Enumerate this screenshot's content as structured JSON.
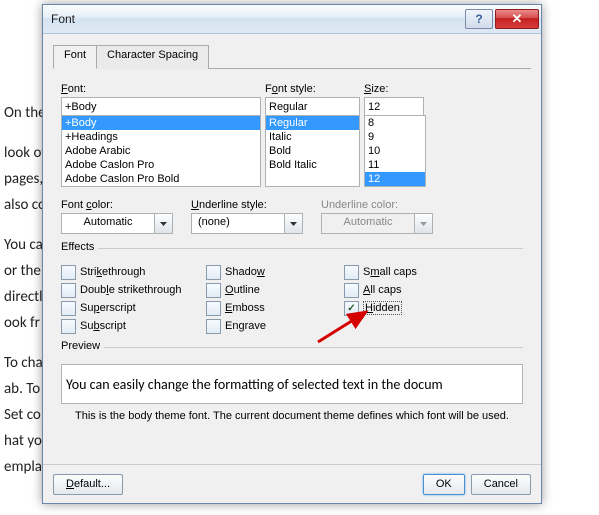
{
  "bg": {
    "p1": "On the                                                                                                                                                 the overall",
    "p2": "look of                                                                                                                                         ers, lists, co",
    "p3": "pages,                                                                                                                                          diagrams, th",
    "p4": "also co",
    "p5": "You ca                                                                                                                                           osing a look",
    "p6": "or the                                                                                                                                            format text",
    "p7": "directl                                                                                                                                       e of using th",
    "p8": "ook fr",
    "p9": "To cha                                                                                                                                            e Page Layo",
    "p10": "ab. To                                                                                                                                            ent Quick St",
    "p11": "Set co                                                                                                                                           command s",
    "p12": "hat yo                                                                                                                                            n your curre",
    "p13": "empla"
  },
  "dialog": {
    "title": "Font",
    "tabs": {
      "font": "Font",
      "spacing": "Character Spacing"
    },
    "font_label": "Font:",
    "font_value": "+Body",
    "font_list": [
      "+Body",
      "+Headings",
      "Adobe Arabic",
      "Adobe Caslon Pro",
      "Adobe Caslon Pro Bold"
    ],
    "font_selected": 0,
    "style_label": "Font style:",
    "style_value": "Regular",
    "style_list": [
      "Regular",
      "Italic",
      "Bold",
      "Bold Italic"
    ],
    "style_selected": 0,
    "size_label": "Size:",
    "size_value": "12",
    "size_list": [
      "8",
      "9",
      "10",
      "11",
      "12"
    ],
    "size_selected": 4,
    "font_color_label": "Font color:",
    "font_color_value": "Automatic",
    "underline_style_label": "Underline style:",
    "underline_style_value": "(none)",
    "underline_color_label": "Underline color:",
    "underline_color_value": "Automatic",
    "effects_label": "Effects",
    "effects": {
      "strikethrough": "Strikethrough",
      "double_strikethrough": "Double strikethrough",
      "superscript": "Superscript",
      "subscript": "Subscript",
      "shadow": "Shadow",
      "outline": "Outline",
      "emboss": "Emboss",
      "engrave": "Engrave",
      "small_caps": "Small caps",
      "all_caps": "All caps",
      "hidden": "Hidden"
    },
    "effects_checked": {
      "hidden": true
    },
    "preview_label": "Preview",
    "preview_text": "You can easily change the formatting of selected text in the docum",
    "preview_note": "This is the body theme font. The current document theme defines which font will be used.",
    "default_btn": "Default...",
    "ok_btn": "OK",
    "cancel_btn": "Cancel"
  }
}
